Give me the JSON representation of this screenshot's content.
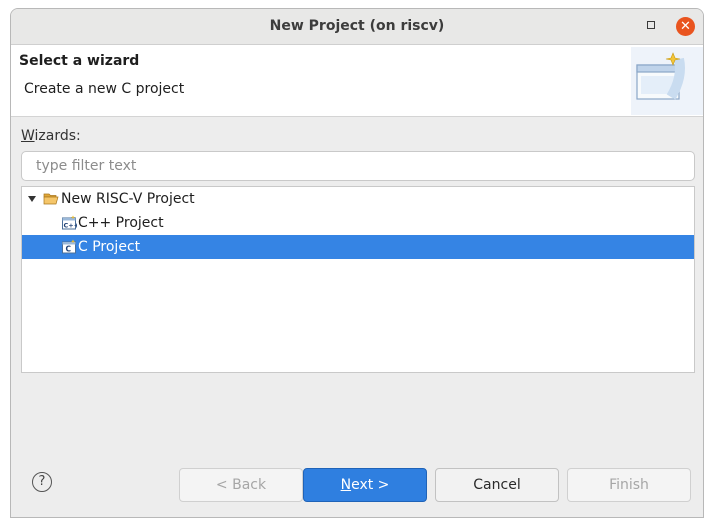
{
  "window": {
    "title": "New Project  (on riscv)",
    "close_glyph": "✕"
  },
  "header": {
    "title": "Select a wizard",
    "description": "Create a new C project",
    "art_icon": "new-wizard-banner-icon"
  },
  "wizards": {
    "label_mnemonic": "W",
    "label_rest": "izards:",
    "filter_placeholder": "type filter text",
    "filter_value": ""
  },
  "tree": {
    "items": [
      {
        "label": "New RISC-V Project",
        "icon": "folder-open-icon",
        "expanded": true,
        "level": 0,
        "selected": false
      },
      {
        "label": "C++ Project",
        "icon": "cpp-project-icon",
        "level": 1,
        "selected": false
      },
      {
        "label": "C Project",
        "icon": "c-project-icon",
        "level": 1,
        "selected": true
      }
    ]
  },
  "footer": {
    "help_glyph": "?",
    "back_label": "< Back",
    "next_mnemonic": "N",
    "next_rest": "ext >",
    "cancel_label": "Cancel",
    "finish_label": "Finish"
  },
  "colors": {
    "selection": "#3584e4",
    "primary_button": "#2f7fe0",
    "close_button": "#e9541f"
  }
}
